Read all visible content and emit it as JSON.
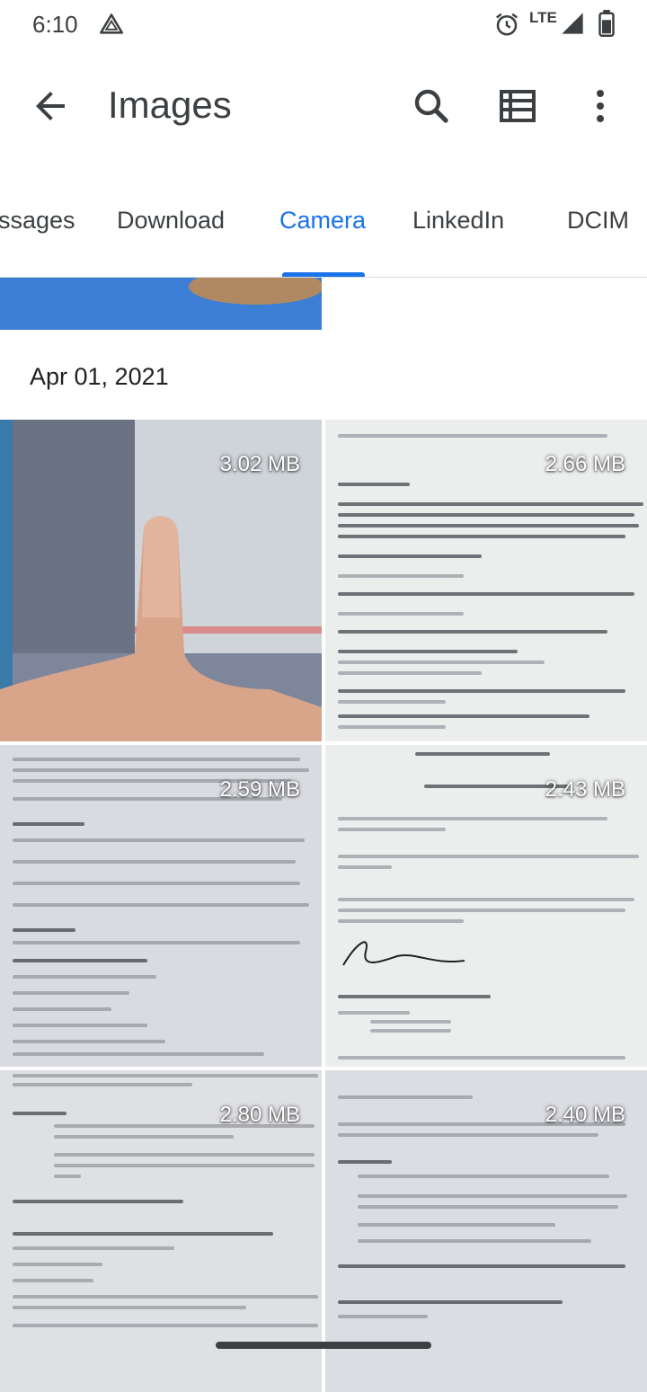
{
  "status_bar": {
    "time": "6:10",
    "network": "LTE"
  },
  "app_bar": {
    "title": "Images"
  },
  "tabs": [
    {
      "label": "Messages",
      "display": "ssages"
    },
    {
      "label": "Download"
    },
    {
      "label": "Camera",
      "active": true
    },
    {
      "label": "LinkedIn"
    },
    {
      "label": "DCIM"
    }
  ],
  "section": {
    "date": "Apr 01, 2021"
  },
  "images": [
    {
      "size": "3.02 MB"
    },
    {
      "size": "2.66 MB"
    },
    {
      "size": "2.59 MB"
    },
    {
      "size": "2.43 MB"
    },
    {
      "size": "2.80 MB"
    },
    {
      "size": "2.40 MB"
    }
  ],
  "colors": {
    "accent": "#1a73e8",
    "text": "#3c4043"
  }
}
